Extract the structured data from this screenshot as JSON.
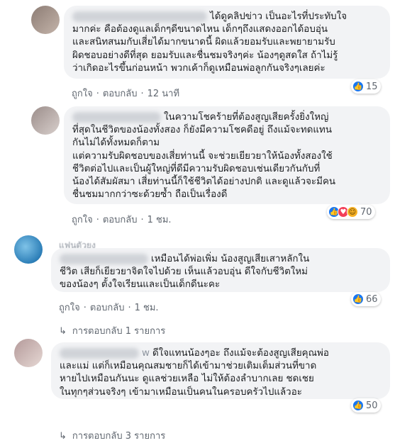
{
  "comments": [
    {
      "text": "ได้ดูคลิปข่าว เป็นอะไรที่ประทับใจ\nมากค่ะ คือต้องดูแลเด็กๆดีขนาดไหน เด็กๆถึงแสดงออกได้อบอุ่น\nและสนิทสนมกับเสี่ยได้มากขนาดนี้ ผิดแล้วยอมรับและพยายามรับ\nผิดชอบอย่างดีที่สุด ยอมรับและชื่นชมจริงๆค่ะ น้องๆดูสดใส ถ้าไม่รู้\nว่าเกิดอะไรขึ้นก่อนหน้า พวกเค้าก็ดูเหมือนพ่อลูกกันจริงๆเลยค่ะ",
      "like": "ถูกใจ",
      "reply": "ตอบกลับ",
      "time": "12 นาที",
      "reaction_count": "15"
    },
    {
      "text": "ในความโชคร้ายที่ต้องสูญเสียครั้งยิ่งใหญ่\nที่สุดในชีวิตของน้องทั้งสอง ก็ยังมีความโชคดีอยู่ ถึงแม้จะทดแทน\nกันไม่ได้ทั้งหมดก็ตาม\nแต่ความรับผิดชอบของเสี่ยท่านนี้ จะช่วยเยียวยาให้น้องทั้งสองใช้\nชีวิตต่อไปและเป็นผู้ใหญ่ที่ดีมีความรับผิดชอบเช่นเดียวกันกับที่\nน้องได้สัมผัสมา เสี่ยท่านนี้ก็ใช้ชีวิตได้อย่างปกติ และดูแล้วจะมีคน\nชื่นชมมากกว่าซะด้วยซ้ำ ถือเป็นเรื่องดี",
      "like": "ถูกใจ",
      "reply": "ตอบกลับ",
      "time": "1 ชม.",
      "reaction_count": "70"
    },
    {
      "subname": "แฟนตัวยง",
      "text": "เหมือนได้พ่อเพิ่ม น้องสูญเสียเสาหลักใน\nชีวิต เสียก็เยียวยาจิตใจไปด้วย เห็นแล้วอบอุ่น ดีใจกับชีวิตใหม่\nของน้องๆ ตั้งใจเรียนและเป็นเด็กดีนะคะ",
      "like": "ถูกใจ",
      "reply": "ตอบกลับ",
      "time": "1 ชม.",
      "reaction_count": "66",
      "replies_label": "การตอบกลับ 1 รายการ"
    },
    {
      "name_suffix": "w",
      "text": "ดีใจแทนน้องๆอะ ถึงแม้จะต้องสูญเสียคุณพ่อ\nและแม่ แต่ก็เหมือนคุณสมชายก็ได้เข้ามาช่วยเติมเต็มส่วนที่ขาด\nหายไปเหมือนกันนะ ดูแลช่วยเหลือ ไม่ให้ต้องลำบากเลย ชดเชย\nในทุกๆส่วนจริงๆ เข้ามาเหมือนเป็นคนในครอบครัวไปแล้วอะ",
      "reaction_count": "50",
      "replies_label": "การตอบกลับ 3 รายการ"
    }
  ],
  "colors": {
    "bubble": "#f2f3f5",
    "like_blue": "#1877f2",
    "love_red": "#f33e58",
    "haha_yellow": "#f7b125",
    "meta_gray": "#606770"
  }
}
